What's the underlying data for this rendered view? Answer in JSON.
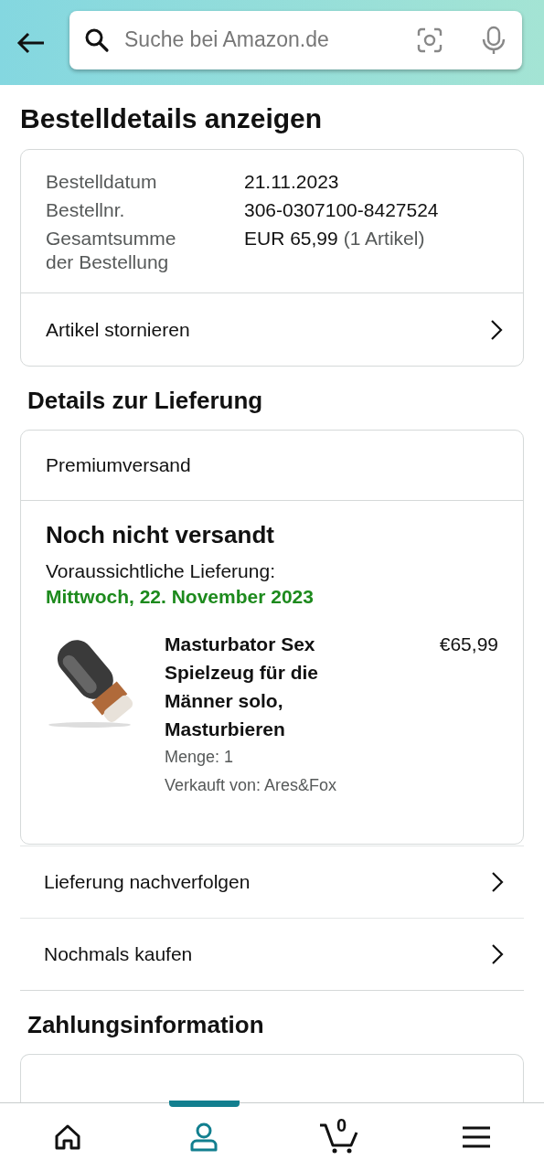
{
  "search": {
    "placeholder": "Suche bei Amazon.de"
  },
  "title": "Bestelldetails anzeigen",
  "order_summary": {
    "rows": [
      {
        "label": "Bestelldatum",
        "value": "21.11.2023"
      },
      {
        "label": "Bestellnr.",
        "value": "306-0307100-8427524"
      },
      {
        "label": "Gesamtsumme der Bestellung",
        "value": "EUR 65,99",
        "note": "(1 Artikel)"
      }
    ],
    "action": "Artikel stornieren"
  },
  "delivery": {
    "heading": "Details zur Lieferung",
    "shipping_method": "Premiumversand",
    "status": "Noch nicht versandt",
    "expected_label": "Voraussichtliche Lieferung:",
    "expected_date": "Mittwoch, 22. November 2023",
    "item": {
      "kind": "picture",
      "title": "Masturbator Sex Spielzeug für die Männer solo, Masturbieren",
      "price": "€65,99",
      "quantity": "Menge: 1",
      "seller": "Verkauft von: Ares&Fox"
    }
  },
  "actions": [
    "Lieferung nachverfolgen",
    "Nochmals kaufen"
  ],
  "payment": {
    "heading": "Zahlungsinformation"
  },
  "bottom_nav": [
    {
      "kind": "home",
      "selected": false
    },
    {
      "kind": "account",
      "selected": true
    },
    {
      "kind": "cart",
      "selected": false,
      "count": "0"
    },
    {
      "kind": "menu",
      "selected": false
    }
  ]
}
